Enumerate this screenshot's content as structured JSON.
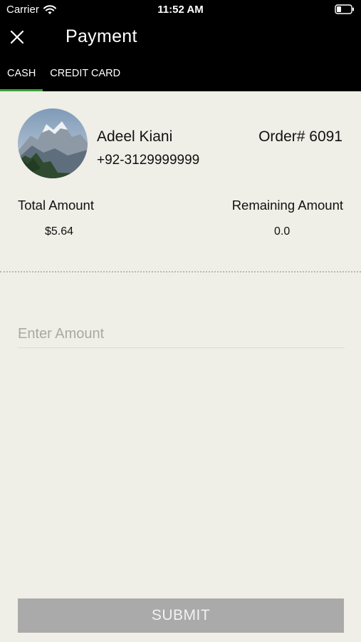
{
  "status_bar": {
    "carrier": "Carrier",
    "time": "11:52 AM",
    "wifi_icon": "wifi-icon",
    "battery_icon": "battery-icon"
  },
  "nav": {
    "title": "Payment",
    "close_icon": "close-icon"
  },
  "tabs": [
    {
      "label": "CASH",
      "active": true
    },
    {
      "label": "CREDIT CARD",
      "active": false
    }
  ],
  "colors": {
    "header_bg": "#000000",
    "tab_indicator": "#3aa23a",
    "page_bg": "#efeee7",
    "submit_bg": "#aaaaaa"
  },
  "customer": {
    "name": "Adeel Kiani",
    "phone": "+92-3129999999",
    "avatar": "mountain-landscape-photo"
  },
  "order": {
    "number_label": "Order# 6091"
  },
  "amounts": {
    "total_label": "Total Amount",
    "total_value": "$5.64",
    "remaining_label": "Remaining Amount",
    "remaining_value": "0.0"
  },
  "amount_input": {
    "placeholder": "Enter Amount",
    "value": ""
  },
  "submit": {
    "label": "SUBMIT"
  }
}
